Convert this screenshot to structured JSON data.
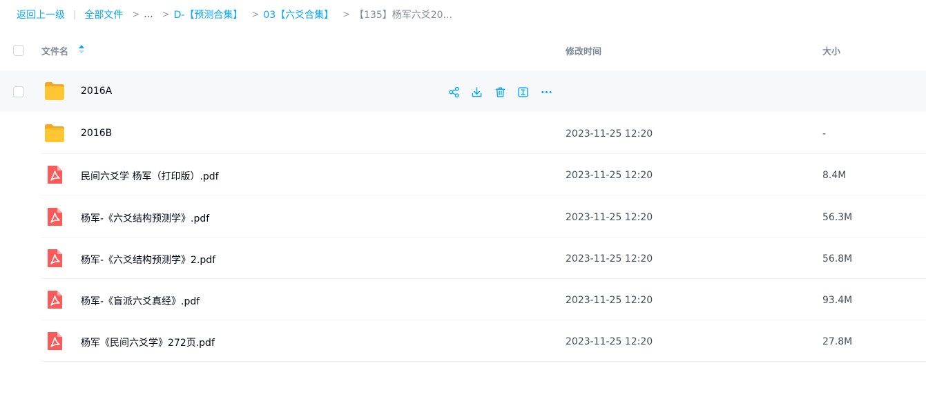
{
  "breadcrumb": {
    "back": "返回上一级",
    "all_files": "全部文件",
    "ellipsis": "...",
    "level1": "D-【预测合集】",
    "level2": "03【六爻合集】",
    "current": "【135】杨军六爻20..."
  },
  "table": {
    "headers": {
      "name": "文件名",
      "modified": "修改时间",
      "size": "大小"
    },
    "rows": [
      {
        "type": "folder",
        "name": "2016A",
        "modified": "",
        "size": "",
        "hovered": true
      },
      {
        "type": "folder",
        "name": "2016B",
        "modified": "2023-11-25 12:20",
        "size": "-"
      },
      {
        "type": "pdf",
        "name": "民间六爻学 杨军（打印版）.pdf",
        "modified": "2023-11-25 12:20",
        "size": "8.4M"
      },
      {
        "type": "pdf",
        "name": "杨军-《六爻结构预测学》.pdf",
        "modified": "2023-11-25 12:20",
        "size": "56.3M"
      },
      {
        "type": "pdf",
        "name": "杨军-《六爻结构预测学》2.pdf",
        "modified": "2023-11-25 12:20",
        "size": "56.8M"
      },
      {
        "type": "pdf",
        "name": "杨军-《盲派六爻真经》.pdf",
        "modified": "2023-11-25 12:20",
        "size": "93.4M"
      },
      {
        "type": "pdf",
        "name": "杨军《民间六爻学》272页.pdf",
        "modified": "2023-11-25 12:20",
        "size": "27.8M"
      }
    ]
  },
  "row_actions": [
    "share-icon",
    "download-icon",
    "delete-icon",
    "rename-icon",
    "more-icon"
  ],
  "colors": {
    "accent": "#06a7ff",
    "folder": "#ffc634",
    "pdf": "#fa5a5a",
    "hover_row": "#f7f8fa"
  }
}
